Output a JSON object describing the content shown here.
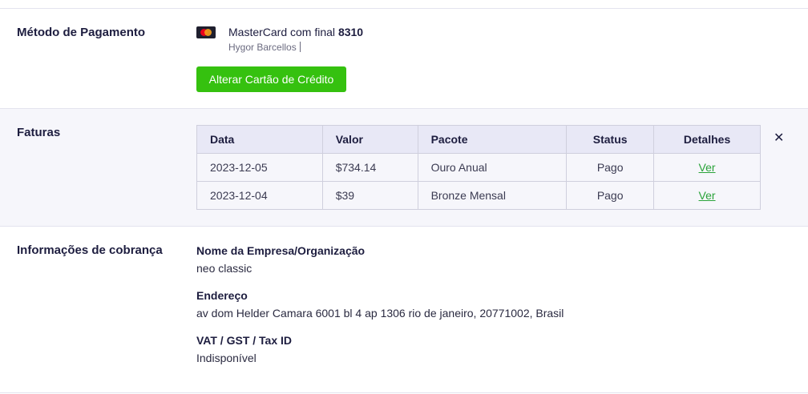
{
  "payment": {
    "title": "Método de Pagamento",
    "card_prefix": "MasterCard com final",
    "card_last4": "8310",
    "card_owner": "Hygor Barcellos",
    "card_icon": "mastercard-icon",
    "change_button": "Alterar Cartão de Crédito",
    "button_color": "#35c10f"
  },
  "invoices": {
    "title": "Faturas",
    "close_icon": "close-icon",
    "headers": [
      "Data",
      "Valor",
      "Pacote",
      "Status",
      "Detalhes"
    ],
    "rows": [
      {
        "date": "2023-12-05",
        "value": "$734.14",
        "package": "Ouro Anual",
        "status": "Pago",
        "details": "Ver"
      },
      {
        "date": "2023-12-04",
        "value": "$39",
        "package": "Bronze Mensal",
        "status": "Pago",
        "details": "Ver"
      }
    ]
  },
  "billing": {
    "title": "Informações de cobrança",
    "company_label": "Nome da Empresa/Organização",
    "company_value": "neo classic",
    "address_label": "Endereço",
    "address_value": "av dom Helder Camara 6001 bl 4 ap 1306 rio de janeiro, 20771002, Brasil",
    "tax_label": "VAT / GST / Tax ID",
    "tax_value": "Indisponível"
  }
}
